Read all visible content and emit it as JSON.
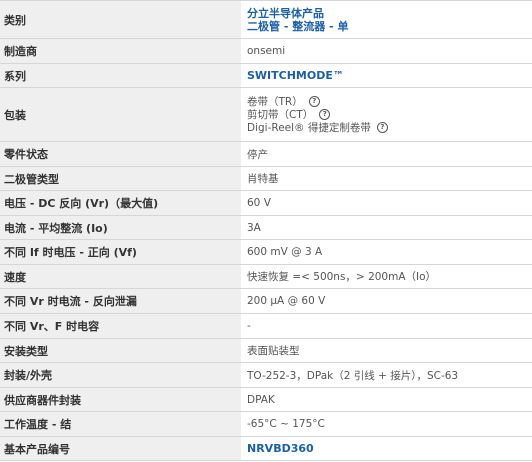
{
  "rows": [
    {
      "label": "类别",
      "values": [
        "分立半导体产品",
        "二极管 - 整流器 - 单"
      ],
      "link": true
    },
    {
      "label": "制造商",
      "value": "onsemi"
    },
    {
      "label": "系列",
      "value": "SWITCHMODE™",
      "link": true
    },
    {
      "label": "包装",
      "packaging": [
        "卷带（TR）",
        "剪切带（CT）",
        "Digi-Reel® 得捷定制卷带"
      ]
    },
    {
      "label": "零件状态",
      "value": "停产"
    },
    {
      "label": "二极管类型",
      "value": "肖特基"
    },
    {
      "label": "电压 - DC 反向 (Vr)（最大值)",
      "value": "60 V"
    },
    {
      "label": "电流 - 平均整流 (Io)",
      "value": "3A"
    },
    {
      "label": "不同 If 时电压 - 正向 (Vf)",
      "value": "600 mV @ 3 A"
    },
    {
      "label": "速度",
      "value": "快速恢复 =< 500ns，> 200mA（Io）"
    },
    {
      "label": "不同 Vr 时电流 - 反向泄漏",
      "value": "200 µA @ 60 V"
    },
    {
      "label": "不同 Vr、F 时电容",
      "value": "-"
    },
    {
      "label": "安装类型",
      "value": "表面贴装型"
    },
    {
      "label": "封装/外壳",
      "value": "TO-252-3，DPak（2 引线 + 接片），SC-63"
    },
    {
      "label": "供应商器件封装",
      "value": "DPAK"
    },
    {
      "label": "工作温度 - 结",
      "value": "-65°C ~ 175°C"
    },
    {
      "label": "基本产品编号",
      "value": "NRVBD360",
      "link": true
    }
  ],
  "help_glyph": "?",
  "colors": {
    "label_bg": "#efefef",
    "link": "#1a5fa8",
    "border": "#d6d6d6"
  }
}
